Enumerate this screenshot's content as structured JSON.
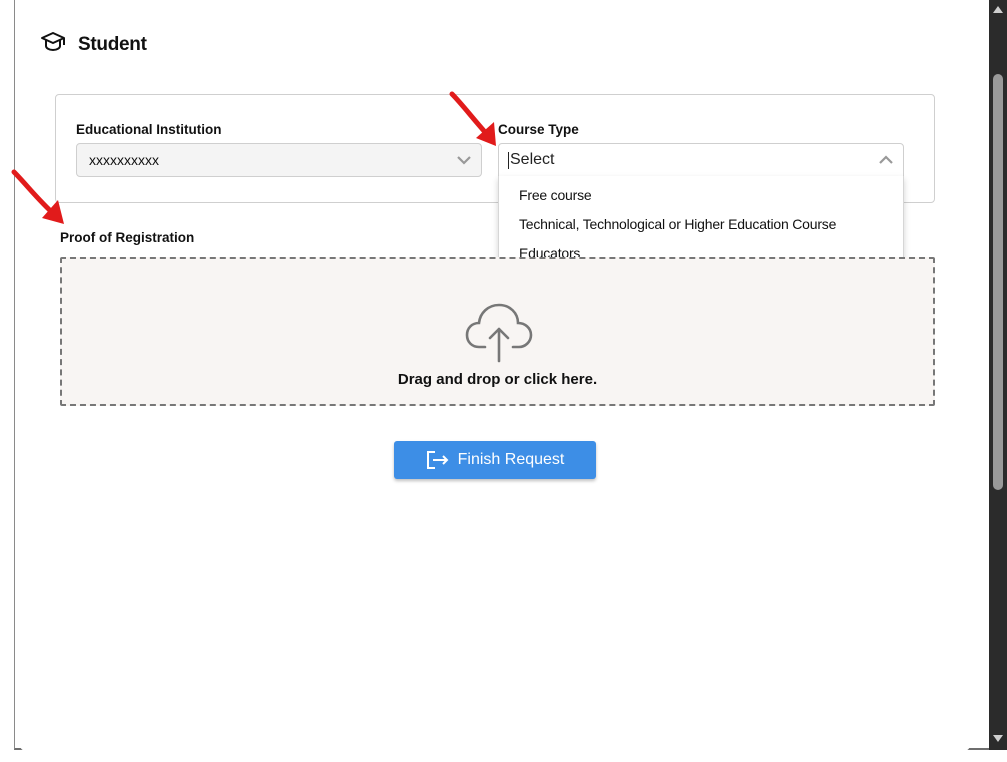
{
  "header": {
    "title": "Student",
    "icon": "graduation-cap-icon"
  },
  "form": {
    "institution": {
      "label": "Educational Institution",
      "value": "xxxxxxxxxx"
    },
    "course_type": {
      "label": "Course Type",
      "value": "Select",
      "options": [
        "Free course",
        "Technical, Technological or Higher Education Course",
        "Educators"
      ]
    },
    "proof": {
      "label": "Proof of Registration",
      "dropzone_text": "Drag and drop or click here."
    }
  },
  "actions": {
    "finish_label": "Finish Request"
  },
  "colors": {
    "accent_band": "#6c47e4",
    "button": "#3d8ee6",
    "annotation": "#e11b1b"
  }
}
